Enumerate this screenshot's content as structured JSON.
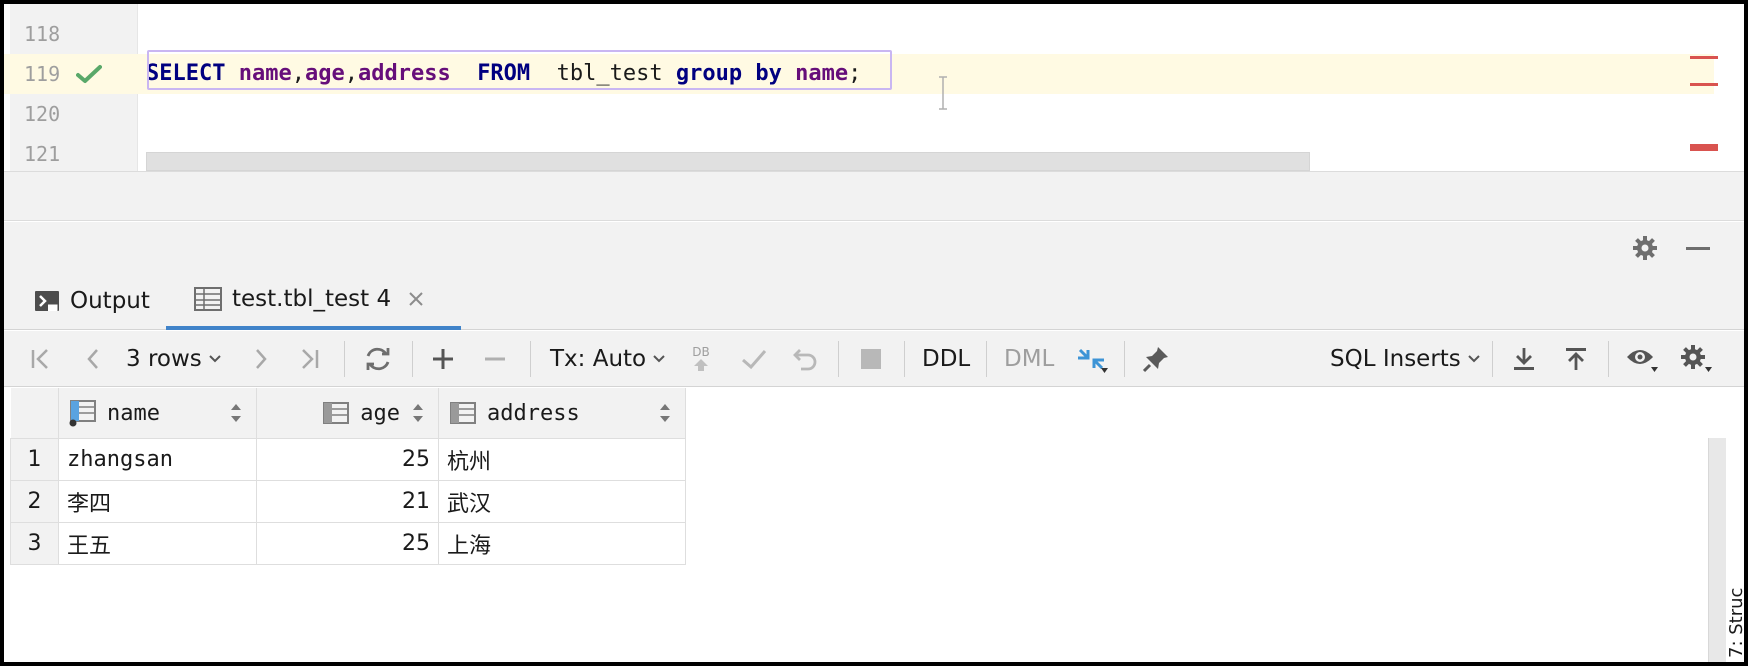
{
  "editor": {
    "lines": [
      {
        "number": "118"
      },
      {
        "number": "119"
      },
      {
        "number": "120"
      },
      {
        "number": "121"
      }
    ],
    "sql": {
      "kw_select": "SELECT",
      "col_name": "name",
      "comma1": ",",
      "col_age": "age",
      "comma2": ",",
      "col_address": "address",
      "kw_from": "FROM",
      "table": "tbl_test",
      "kw_group": "group",
      "kw_by": "by",
      "col_group": "name",
      "semicolon": ";"
    }
  },
  "tabs": [
    {
      "label": "Output"
    },
    {
      "label": "test.tbl_test 4"
    }
  ],
  "toolbar": {
    "rows_label": "3 rows",
    "tx_label": "Tx: Auto",
    "db_label": "DB",
    "ddl_label": "DDL",
    "dml_label": "DML",
    "export_label": "SQL Inserts"
  },
  "grid": {
    "columns": [
      "name",
      "age",
      "address"
    ],
    "rows": [
      {
        "num": "1",
        "name": "zhangsan",
        "age": "25",
        "address": "杭州"
      },
      {
        "num": "2",
        "name": "李四",
        "age": "21",
        "address": "武汉"
      },
      {
        "num": "3",
        "name": "王五",
        "age": "25",
        "address": "上海"
      }
    ]
  },
  "side_panel": {
    "label": "7: Struc"
  },
  "colors": {
    "keyword": "#000080",
    "column": "#660e7a",
    "active_tab": "#4083c9",
    "current_line": "#fffae3",
    "error_mark": "#d9534f",
    "check": "#59a869"
  }
}
